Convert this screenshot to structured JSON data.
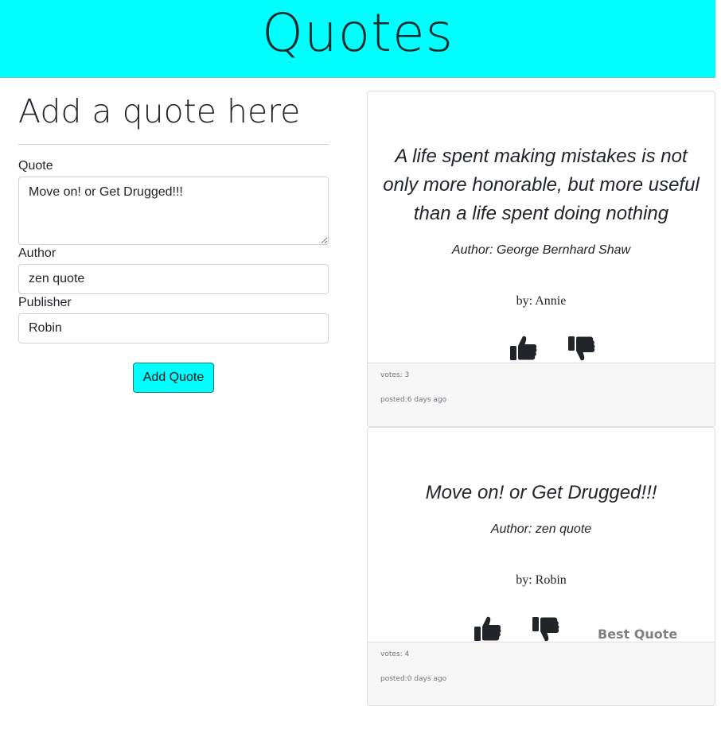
{
  "header": {
    "title": "Quotes"
  },
  "form": {
    "heading": "Add a quote here",
    "quote_label": "Quote",
    "quote_value": "Move on! or Get Drugged!!!",
    "author_label": "Author",
    "author_value": "zen quote",
    "publisher_label": "Publisher",
    "publisher_value": "Robin",
    "submit_label": "Add Quote"
  },
  "quotes": [
    {
      "text": "A life spent making mistakes is not only more honorable, but more useful than a life spent doing nothing",
      "author": "Author: George Bernhard Shaw",
      "publisher": "by: Annie",
      "votes": "votes: 3",
      "posted": "posted:6 days ago",
      "upvote_icon": "thumbs-up-icon",
      "downvote_icon": "thumbs-down-icon"
    },
    {
      "text": "Move on! or Get Drugged!!!",
      "author": "Author: zen quote",
      "publisher": "by: Robin",
      "votes": "votes: 4",
      "posted": "posted:0 days ago",
      "badge": "Best Quote",
      "upvote_icon": "thumbs-up-icon",
      "downvote_icon": "thumbs-down-icon"
    }
  ],
  "colors": {
    "header_bg": "#00ffff",
    "button_bg": "#00ffff",
    "footer_bg": "#f7f7f7"
  }
}
